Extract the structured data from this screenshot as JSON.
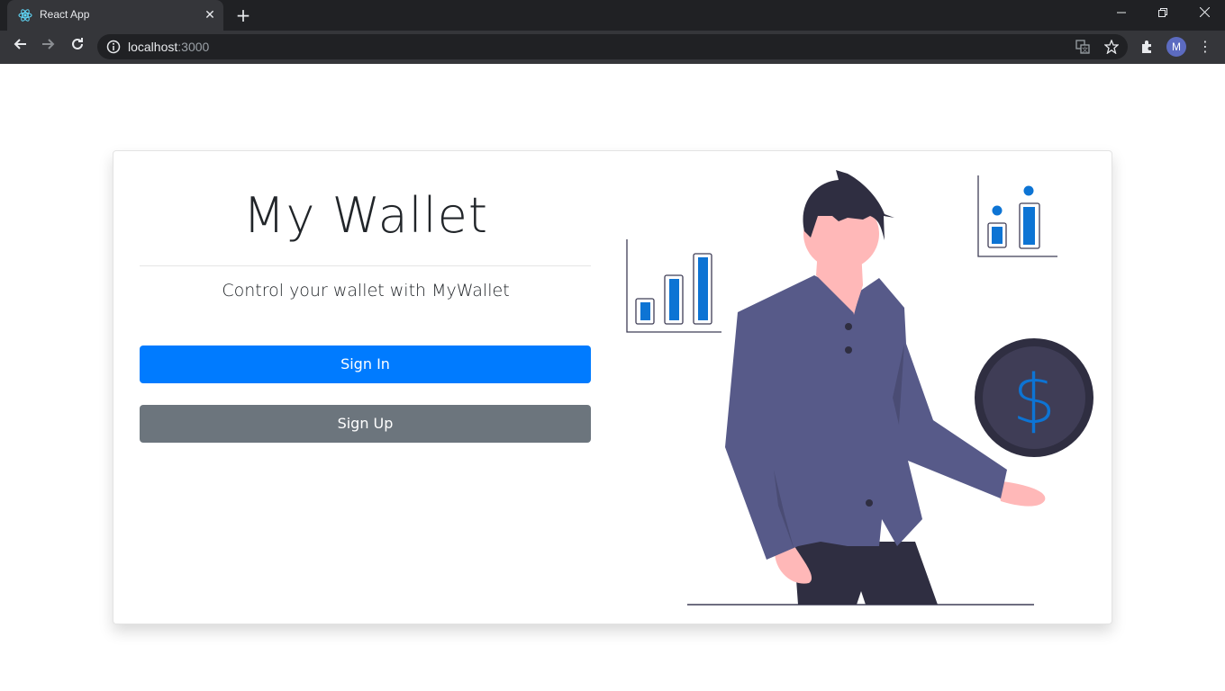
{
  "browser": {
    "tab_title": "React App",
    "tab_close": "✕",
    "new_tab": "+",
    "url_host": "localhost",
    "url_port": ":3000",
    "avatar_letter": "M",
    "window_controls": {
      "minimize": "—",
      "restore": "❐",
      "close": "✕"
    },
    "nav": {
      "back": "←",
      "forward": "→",
      "reload": "↻"
    },
    "menu": "⋮"
  },
  "page": {
    "title": "My Wallet",
    "subtitle": "Control your wallet with MyWallet",
    "sign_in_label": "Sign In",
    "sign_up_label": "Sign Up",
    "illustration": {
      "dollar_symbol": "$"
    }
  },
  "colors": {
    "primary": "#007bff",
    "secondary": "#6c757d",
    "shirt": "#575a89",
    "pants": "#2f2e41",
    "skin": "#ffb8b8",
    "coin": "#3f3d56",
    "bar_blue": "#0d74d4"
  }
}
